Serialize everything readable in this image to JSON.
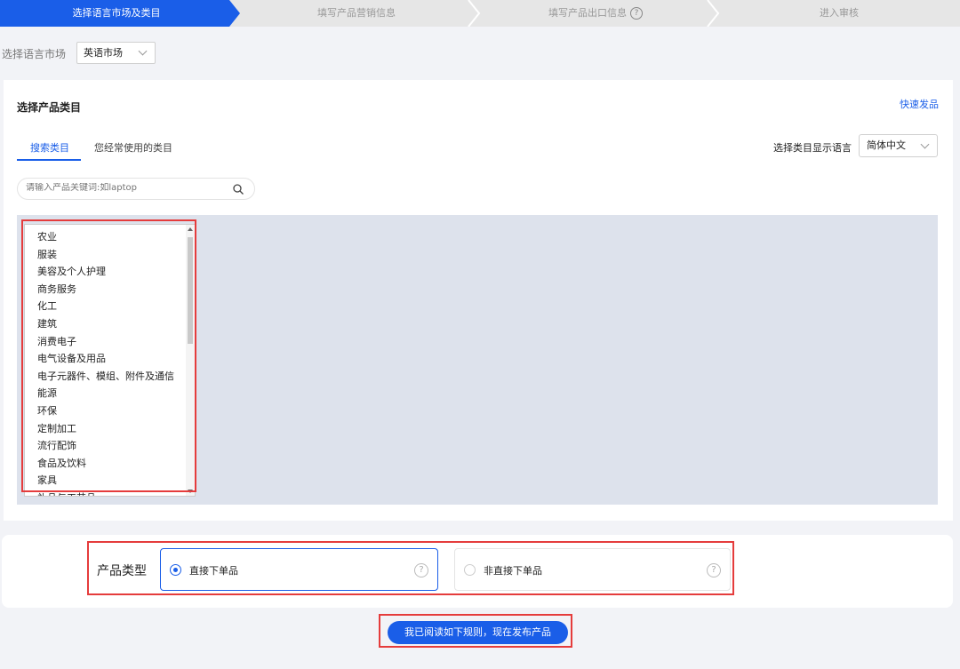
{
  "steps": [
    {
      "label": "选择语言市场及类目",
      "active": true
    },
    {
      "label": "填写产品营销信息",
      "active": false
    },
    {
      "label": "填写产品出口信息",
      "active": false,
      "help": "?"
    },
    {
      "label": "进入审核",
      "active": false
    }
  ],
  "market": {
    "label": "选择语言市场",
    "value": "英语市场"
  },
  "category_panel": {
    "title": "选择产品类目",
    "quick_link": "快速发品",
    "tabs": [
      "搜索类目",
      "您经常使用的类目"
    ],
    "lang_label": "选择类目显示语言",
    "lang_value": "简体中文",
    "search_placeholder": "请输入产品关键词:如laptop",
    "categories": [
      "农业",
      "服装",
      "美容及个人护理",
      "商务服务",
      "化工",
      "建筑",
      "消费电子",
      "电气设备及用品",
      "电子元器件、模组、附件及通信",
      "能源",
      "环保",
      "定制加工",
      "流行配饰",
      "食品及饮料",
      "家具",
      "礼品与工艺品"
    ]
  },
  "product_type": {
    "label": "产品类型",
    "options": [
      {
        "label": "直接下单品",
        "selected": true,
        "help": "?"
      },
      {
        "label": "非直接下单品",
        "selected": false,
        "help": "?"
      }
    ]
  },
  "publish_button": "我已阅读如下规则，现在发布产品",
  "colors": {
    "accent": "#1a5ee8",
    "highlight": "#e53c3c",
    "step_inactive": "#e6e6e6"
  }
}
